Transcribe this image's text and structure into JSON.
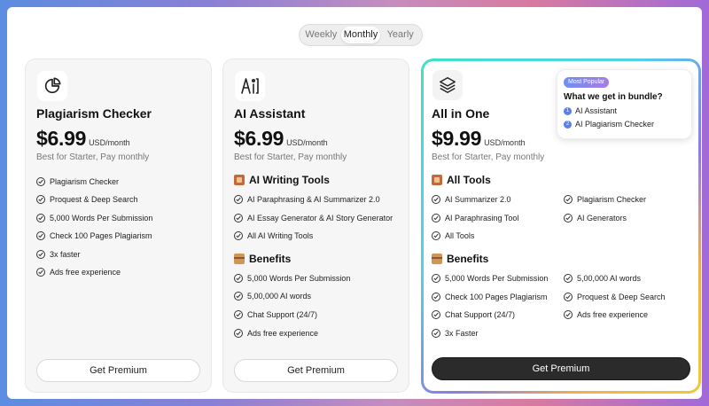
{
  "period_toggle": {
    "options": [
      "Weekly",
      "Monthly",
      "Yearly"
    ],
    "selected": "Monthly"
  },
  "plans": [
    {
      "icon": "pie-chart-icon",
      "title": "Plagiarism Checker",
      "price": "$6.99",
      "unit": "USD/month",
      "subtitle": "Best for Starter, Pay monthly",
      "features": [
        "Plagiarism Checker",
        "Proquest & Deep Search",
        "5,000 Words Per Submission",
        "Check 100 Pages Plagiarism",
        "3x faster",
        "Ads free experience"
      ],
      "button": "Get Premium"
    },
    {
      "icon": "ai-text-icon",
      "title": "AI Assistant",
      "price": "$6.99",
      "unit": "USD/month",
      "subtitle": "Best for Starter, Pay monthly",
      "sections": [
        {
          "title": "AI Writing Tools",
          "icon": "book-icon",
          "items": [
            "AI Paraphrasing & AI Summarizer 2.0",
            "AI Essay Generator & AI Story Generator",
            "All AI Writing Tools"
          ]
        },
        {
          "title": "Benefits",
          "icon": "box-icon",
          "items": [
            "5,000 Words Per Submission",
            "5,00,000 AI words",
            "Chat Support (24/7)",
            "Ads free experience"
          ]
        }
      ],
      "button": "Get Premium"
    },
    {
      "icon": "layers-icon",
      "title": "All in One",
      "price": "$9.99",
      "unit": "USD/month",
      "subtitle": "Best for Starter, Pay monthly",
      "bundle": {
        "badge": "Most Popular",
        "title": "What we get in bundle?",
        "items": [
          {
            "num": "1",
            "label": "AI Assistant"
          },
          {
            "num": "2",
            "label": "AI Plagiarism Checker"
          }
        ]
      },
      "sections": [
        {
          "title": "All Tools",
          "icon": "book-icon",
          "items": [
            "AI Summarizer 2.0",
            "Plagiarism Checker",
            "AI Paraphrasing Tool",
            "AI Generators",
            "All Tools"
          ]
        },
        {
          "title": "Benefits",
          "icon": "box-icon",
          "items": [
            "5,000 Words Per Submission",
            "5,00,000 AI words",
            "Check 100 Pages Plagiarism",
            "Proquest & Deep Search",
            "Chat Support (24/7)",
            "Ads free experience",
            "3x Faster"
          ]
        }
      ],
      "button": "Get Premium"
    }
  ]
}
